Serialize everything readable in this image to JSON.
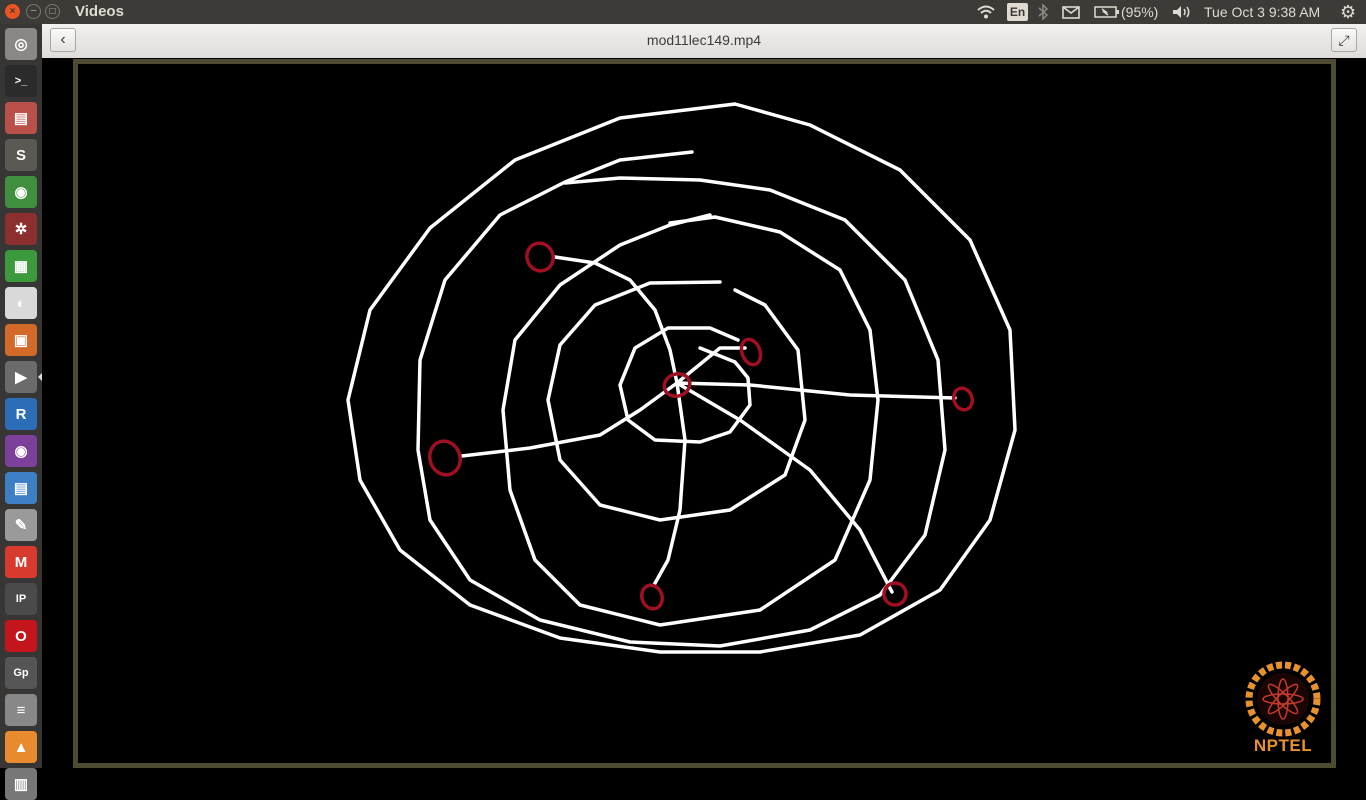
{
  "window": {
    "title": "Videos",
    "close_glyph": "×",
    "min_glyph": "–",
    "max_glyph": "□"
  },
  "tray": {
    "wifi": "wifi-icon",
    "lang": "En",
    "bluetooth": "bluetooth-icon",
    "mail": "mail-icon",
    "battery_text": "(95%)",
    "volume": "volume-icon",
    "clock": "Tue Oct  3  9:38 AM",
    "gear": "gear-icon"
  },
  "launcher": {
    "items": [
      {
        "name": "dash-icon",
        "glyph": "◎",
        "color": "#8a8885"
      },
      {
        "name": "terminal-icon",
        "glyph": ">_",
        "color": "#2b2b2b"
      },
      {
        "name": "files-icon",
        "glyph": "▤",
        "color": "#b9504a"
      },
      {
        "name": "sublime-icon",
        "glyph": "S",
        "color": "#5a5954"
      },
      {
        "name": "chrome-icon",
        "glyph": "◉",
        "color": "#3f8f3f"
      },
      {
        "name": "settings-app-icon",
        "glyph": "✲",
        "color": "#8c2f2f"
      },
      {
        "name": "calc-icon",
        "glyph": "▦",
        "color": "#3c9a3c"
      },
      {
        "name": "evince-icon",
        "glyph": "◐",
        "color": "#d9d9d9"
      },
      {
        "name": "impress-icon",
        "glyph": "▣",
        "color": "#d46a2a"
      },
      {
        "name": "videos-icon",
        "glyph": "▶",
        "color": "#6b6b6b"
      },
      {
        "name": "r-icon",
        "glyph": "R",
        "color": "#2c6db8"
      },
      {
        "name": "media-icon",
        "glyph": "◉",
        "color": "#7c3f9a"
      },
      {
        "name": "writer-icon",
        "glyph": "▤",
        "color": "#3d7fc4"
      },
      {
        "name": "text-editor-icon",
        "glyph": "✎",
        "color": "#9a9a9a"
      },
      {
        "name": "gmail-icon",
        "glyph": "M",
        "color": "#d83a2e"
      },
      {
        "name": "ipython-icon",
        "glyph": "IP",
        "color": "#4a4a4a"
      },
      {
        "name": "opera-icon",
        "glyph": "O",
        "color": "#c4151c"
      },
      {
        "name": "gp-icon",
        "glyph": "Gp",
        "color": "#555555"
      },
      {
        "name": "stack-icon",
        "glyph": "≡",
        "color": "#888888"
      },
      {
        "name": "install-icon",
        "glyph": "▲",
        "color": "#e88a2e"
      },
      {
        "name": "trash-icon",
        "glyph": "▥",
        "color": "#777777"
      }
    ]
  },
  "header": {
    "title": "mod11lec149.mp4",
    "back": "back-icon",
    "fullscreen": "fullscreen-icon"
  },
  "video": {
    "logo_text": "NPTEL",
    "stroke_color": "#ffffff",
    "marker_color": "#a00f22",
    "logo_color": "#e8912f"
  }
}
